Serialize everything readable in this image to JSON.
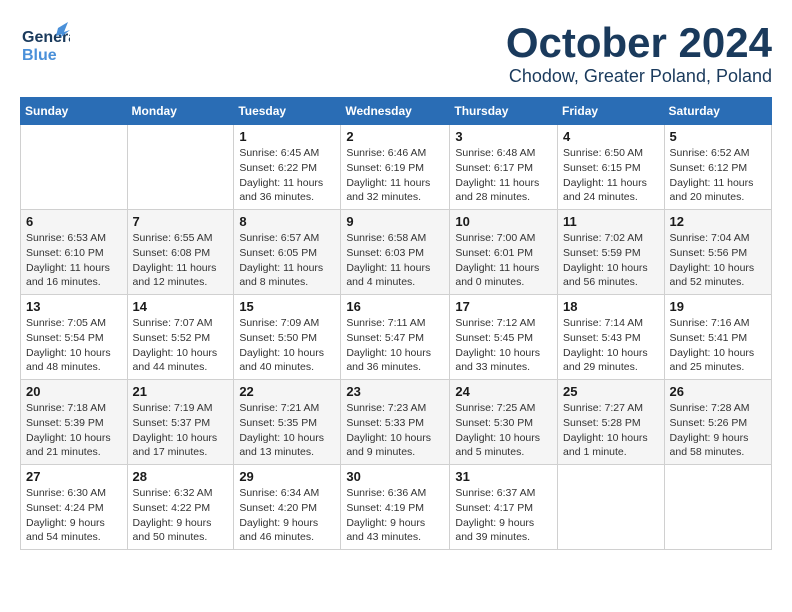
{
  "header": {
    "logo_general": "General",
    "logo_blue": "Blue",
    "month": "October 2024",
    "location": "Chodow, Greater Poland, Poland"
  },
  "weekdays": [
    "Sunday",
    "Monday",
    "Tuesday",
    "Wednesday",
    "Thursday",
    "Friday",
    "Saturday"
  ],
  "weeks": [
    [
      {
        "day": "",
        "detail": ""
      },
      {
        "day": "",
        "detail": ""
      },
      {
        "day": "1",
        "detail": "Sunrise: 6:45 AM\nSunset: 6:22 PM\nDaylight: 11 hours\nand 36 minutes."
      },
      {
        "day": "2",
        "detail": "Sunrise: 6:46 AM\nSunset: 6:19 PM\nDaylight: 11 hours\nand 32 minutes."
      },
      {
        "day": "3",
        "detail": "Sunrise: 6:48 AM\nSunset: 6:17 PM\nDaylight: 11 hours\nand 28 minutes."
      },
      {
        "day": "4",
        "detail": "Sunrise: 6:50 AM\nSunset: 6:15 PM\nDaylight: 11 hours\nand 24 minutes."
      },
      {
        "day": "5",
        "detail": "Sunrise: 6:52 AM\nSunset: 6:12 PM\nDaylight: 11 hours\nand 20 minutes."
      }
    ],
    [
      {
        "day": "6",
        "detail": "Sunrise: 6:53 AM\nSunset: 6:10 PM\nDaylight: 11 hours\nand 16 minutes."
      },
      {
        "day": "7",
        "detail": "Sunrise: 6:55 AM\nSunset: 6:08 PM\nDaylight: 11 hours\nand 12 minutes."
      },
      {
        "day": "8",
        "detail": "Sunrise: 6:57 AM\nSunset: 6:05 PM\nDaylight: 11 hours\nand 8 minutes."
      },
      {
        "day": "9",
        "detail": "Sunrise: 6:58 AM\nSunset: 6:03 PM\nDaylight: 11 hours\nand 4 minutes."
      },
      {
        "day": "10",
        "detail": "Sunrise: 7:00 AM\nSunset: 6:01 PM\nDaylight: 11 hours\nand 0 minutes."
      },
      {
        "day": "11",
        "detail": "Sunrise: 7:02 AM\nSunset: 5:59 PM\nDaylight: 10 hours\nand 56 minutes."
      },
      {
        "day": "12",
        "detail": "Sunrise: 7:04 AM\nSunset: 5:56 PM\nDaylight: 10 hours\nand 52 minutes."
      }
    ],
    [
      {
        "day": "13",
        "detail": "Sunrise: 7:05 AM\nSunset: 5:54 PM\nDaylight: 10 hours\nand 48 minutes."
      },
      {
        "day": "14",
        "detail": "Sunrise: 7:07 AM\nSunset: 5:52 PM\nDaylight: 10 hours\nand 44 minutes."
      },
      {
        "day": "15",
        "detail": "Sunrise: 7:09 AM\nSunset: 5:50 PM\nDaylight: 10 hours\nand 40 minutes."
      },
      {
        "day": "16",
        "detail": "Sunrise: 7:11 AM\nSunset: 5:47 PM\nDaylight: 10 hours\nand 36 minutes."
      },
      {
        "day": "17",
        "detail": "Sunrise: 7:12 AM\nSunset: 5:45 PM\nDaylight: 10 hours\nand 33 minutes."
      },
      {
        "day": "18",
        "detail": "Sunrise: 7:14 AM\nSunset: 5:43 PM\nDaylight: 10 hours\nand 29 minutes."
      },
      {
        "day": "19",
        "detail": "Sunrise: 7:16 AM\nSunset: 5:41 PM\nDaylight: 10 hours\nand 25 minutes."
      }
    ],
    [
      {
        "day": "20",
        "detail": "Sunrise: 7:18 AM\nSunset: 5:39 PM\nDaylight: 10 hours\nand 21 minutes."
      },
      {
        "day": "21",
        "detail": "Sunrise: 7:19 AM\nSunset: 5:37 PM\nDaylight: 10 hours\nand 17 minutes."
      },
      {
        "day": "22",
        "detail": "Sunrise: 7:21 AM\nSunset: 5:35 PM\nDaylight: 10 hours\nand 13 minutes."
      },
      {
        "day": "23",
        "detail": "Sunrise: 7:23 AM\nSunset: 5:33 PM\nDaylight: 10 hours\nand 9 minutes."
      },
      {
        "day": "24",
        "detail": "Sunrise: 7:25 AM\nSunset: 5:30 PM\nDaylight: 10 hours\nand 5 minutes."
      },
      {
        "day": "25",
        "detail": "Sunrise: 7:27 AM\nSunset: 5:28 PM\nDaylight: 10 hours\nand 1 minute."
      },
      {
        "day": "26",
        "detail": "Sunrise: 7:28 AM\nSunset: 5:26 PM\nDaylight: 9 hours\nand 58 minutes."
      }
    ],
    [
      {
        "day": "27",
        "detail": "Sunrise: 6:30 AM\nSunset: 4:24 PM\nDaylight: 9 hours\nand 54 minutes."
      },
      {
        "day": "28",
        "detail": "Sunrise: 6:32 AM\nSunset: 4:22 PM\nDaylight: 9 hours\nand 50 minutes."
      },
      {
        "day": "29",
        "detail": "Sunrise: 6:34 AM\nSunset: 4:20 PM\nDaylight: 9 hours\nand 46 minutes."
      },
      {
        "day": "30",
        "detail": "Sunrise: 6:36 AM\nSunset: 4:19 PM\nDaylight: 9 hours\nand 43 minutes."
      },
      {
        "day": "31",
        "detail": "Sunrise: 6:37 AM\nSunset: 4:17 PM\nDaylight: 9 hours\nand 39 minutes."
      },
      {
        "day": "",
        "detail": ""
      },
      {
        "day": "",
        "detail": ""
      }
    ]
  ]
}
